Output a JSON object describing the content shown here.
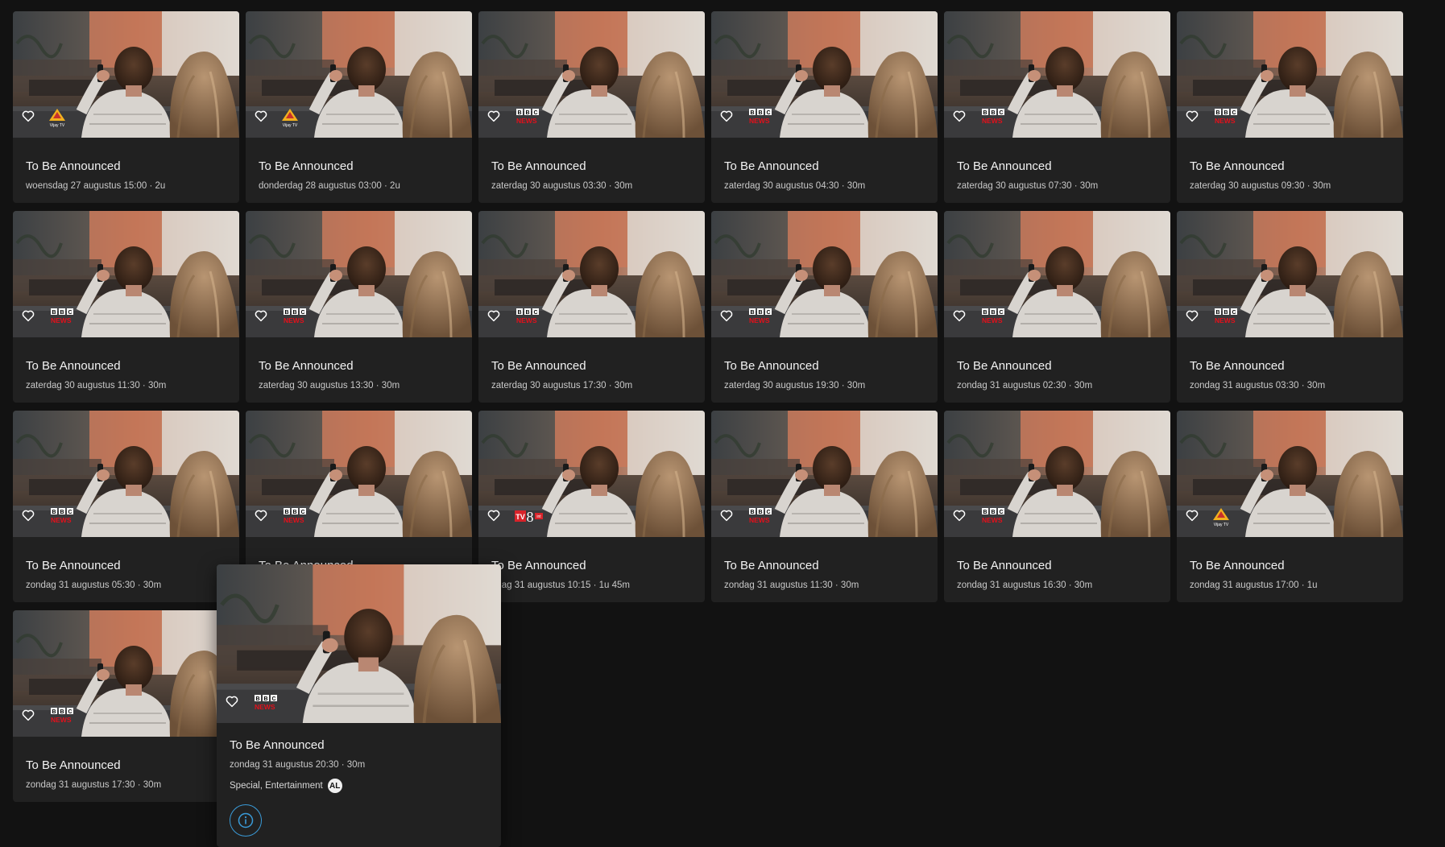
{
  "cards": [
    {
      "title": "To Be Announced",
      "meta": "woensdag 27 augustus 15:00 · 2u",
      "channel": "vijay",
      "channel_label": "Vijay TV"
    },
    {
      "title": "To Be Announced",
      "meta": "donderdag 28 augustus 03:00 · 2u",
      "channel": "vijay",
      "channel_label": "Vijay TV"
    },
    {
      "title": "To Be Announced",
      "meta": "zaterdag 30 augustus 03:30 · 30m",
      "channel": "bbc",
      "channel_label": "NEWS"
    },
    {
      "title": "To Be Announced",
      "meta": "zaterdag 30 augustus 04:30 · 30m",
      "channel": "bbc",
      "channel_label": "NEWS"
    },
    {
      "title": "To Be Announced",
      "meta": "zaterdag 30 augustus 07:30 · 30m",
      "channel": "bbc",
      "channel_label": "NEWS"
    },
    {
      "title": "To Be Announced",
      "meta": "zaterdag 30 augustus 09:30 · 30m",
      "channel": "bbc",
      "channel_label": "NEWS"
    },
    {
      "title": "To Be Announced",
      "meta": "zaterdag 30 augustus 11:30 · 30m",
      "channel": "bbc",
      "channel_label": "NEWS"
    },
    {
      "title": "To Be Announced",
      "meta": "zaterdag 30 augustus 13:30 · 30m",
      "channel": "bbc",
      "channel_label": "NEWS"
    },
    {
      "title": "To Be Announced",
      "meta": "zaterdag 30 augustus 17:30 · 30m",
      "channel": "bbc",
      "channel_label": "NEWS"
    },
    {
      "title": "To Be Announced",
      "meta": "zaterdag 30 augustus 19:30 · 30m",
      "channel": "bbc",
      "channel_label": "NEWS"
    },
    {
      "title": "To Be Announced",
      "meta": "zondag 31 augustus 02:30 · 30m",
      "channel": "bbc",
      "channel_label": "NEWS"
    },
    {
      "title": "To Be Announced",
      "meta": "zondag 31 augustus 03:30 · 30m",
      "channel": "bbc",
      "channel_label": "NEWS"
    },
    {
      "title": "To Be Announced",
      "meta": "zondag 31 augustus 05:30 · 30m",
      "channel": "bbc",
      "channel_label": "NEWS"
    },
    {
      "title": "To Be Announced",
      "meta": "",
      "channel": "bbc",
      "channel_label": "NEWS"
    },
    {
      "title": "To Be Announced",
      "meta": "ndag 31 augustus 10:15 · 1u 45m",
      "channel": "tv8",
      "channel_label": "TV8"
    },
    {
      "title": "To Be Announced",
      "meta": "zondag 31 augustus 11:30 · 30m",
      "channel": "bbc",
      "channel_label": "NEWS"
    },
    {
      "title": "To Be Announced",
      "meta": "zondag 31 augustus 16:30 · 30m",
      "channel": "bbc",
      "channel_label": "NEWS"
    },
    {
      "title": "To Be Announced",
      "meta": "zondag 31 augustus 17:00 · 1u",
      "channel": "vijay",
      "channel_label": "Vijay TV"
    },
    {
      "title": "To Be Announced",
      "meta": "zondag 31 augustus 17:30 · 30m",
      "channel": "bbc",
      "channel_label": "NEWS"
    }
  ],
  "hover": {
    "title": "To Be Announced",
    "meta": "zondag 31 augustus 20:30 · 30m",
    "genres": "Special, Entertainment",
    "rating": "AL",
    "channel": "bbc",
    "channel_label": "NEWS"
  },
  "colors": {
    "background": "#121212",
    "card": "#212121",
    "info_accent": "#3a9bd8",
    "bbc_red": "#e3101b"
  }
}
